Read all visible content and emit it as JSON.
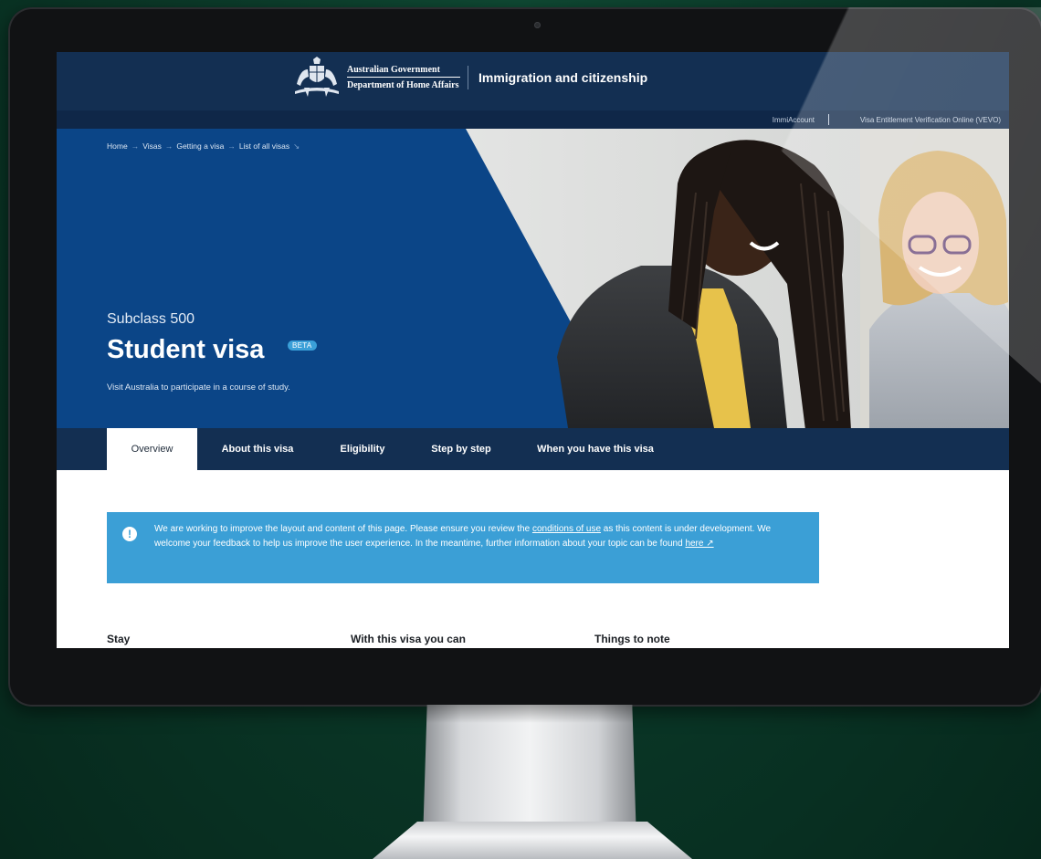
{
  "header": {
    "gov_line1": "Australian Government",
    "gov_line2": "Department of Home Affairs",
    "site_title": "Immigration and citizenship"
  },
  "utility_links": [
    "ImmiAccount",
    "Visa Entitlement Verification Online (VEVO)"
  ],
  "breadcrumb": [
    "Home",
    "Visas",
    "Getting a visa",
    "List of all visas"
  ],
  "hero": {
    "subclass": "Subclass 500",
    "title": "Student visa",
    "badge": "BETA",
    "tagline": "Visit Australia to participate in a course of study."
  },
  "tabs": [
    {
      "label": "Overview",
      "active": true
    },
    {
      "label": "About this visa"
    },
    {
      "label": "Eligibility"
    },
    {
      "label": "Step by step"
    },
    {
      "label": "When you have this visa"
    }
  ],
  "notice": {
    "icon": "alert-icon",
    "text_1": "We are working to improve the layout and content of this page. Please ensure you review the ",
    "link_1": "conditions of use",
    "text_2": " as this content is under development. We welcome your feedback to help us improve the user experience. In the meantime, further information about your topic can be found ",
    "link_2": "here ↗"
  },
  "columns": [
    "Stay",
    "With this visa you can",
    "Things to note"
  ],
  "colors": {
    "header": "#132f52",
    "hero": "#0b4587",
    "notice": "#3b9fd6",
    "background": "#0b3a29"
  }
}
